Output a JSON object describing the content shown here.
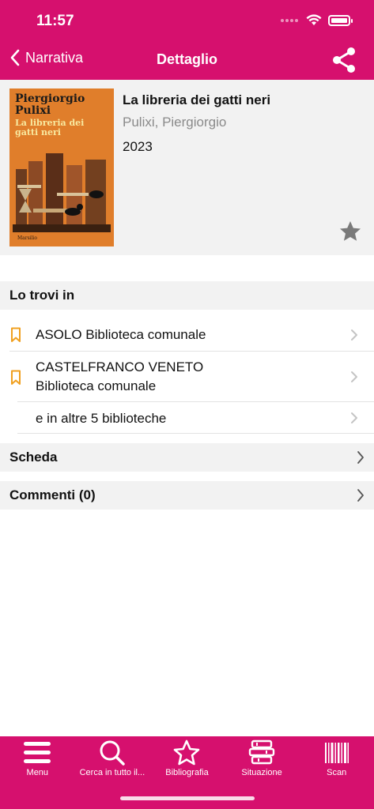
{
  "status_bar": {
    "time": "11:57"
  },
  "nav": {
    "back_label": "Narrativa",
    "title": "Dettaglio"
  },
  "book": {
    "cover_author": "Piergiorgio Pulixi",
    "cover_title": "La libreria dei gatti neri",
    "cover_publisher": "Marsilio",
    "title": "La libreria dei gatti neri",
    "author": "Pulixi, Piergiorgio",
    "year": "2023"
  },
  "availability": {
    "header": "Lo trovi in",
    "libraries": [
      {
        "label": "ASOLO Biblioteca comunale",
        "icon": "bookmark-icon"
      },
      {
        "label_line1": "CASTELFRANCO VENETO",
        "label_line2": "Biblioteca comunale",
        "icon": "bookmark-icon"
      }
    ],
    "more": "e in altre 5 biblioteche"
  },
  "sections": {
    "scheda": "Scheda",
    "comments": "Commenti (0)"
  },
  "tabs": [
    {
      "label": "Menu",
      "icon": "menu-icon"
    },
    {
      "label": "Cerca in tutto il...",
      "icon": "search-icon"
    },
    {
      "label": "Bibliografia",
      "icon": "star-icon"
    },
    {
      "label": "Situazione",
      "icon": "books-icon"
    },
    {
      "label": "Scan",
      "icon": "barcode-icon"
    }
  ],
  "colors": {
    "brand": "#d6106e",
    "bookmark": "#f0a020",
    "panel": "#f2f2f2"
  }
}
